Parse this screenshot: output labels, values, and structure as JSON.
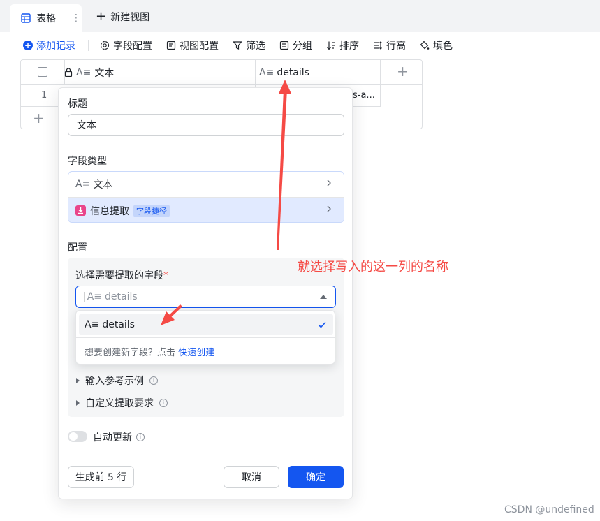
{
  "tabs": {
    "active_label": "表格",
    "more_icon": "more-vertical-icon",
    "new_view_label": "新建视图"
  },
  "toolbar": {
    "add_record": "添加记录",
    "field_config": "字段配置",
    "view_config": "视图配置",
    "filter": "筛选",
    "group": "分组",
    "sort": "排序",
    "row_height": "行高",
    "fill_color": "填色"
  },
  "grid": {
    "col_text": "文本",
    "col_details": "details",
    "row_number": "1",
    "truncated_cell": "s-a..."
  },
  "panel": {
    "title_label": "标题",
    "title_value": "文本",
    "field_type_label": "字段类型",
    "type_text": "文本",
    "type_extract": "信息提取",
    "type_extract_tag": "字段捷径",
    "config_label": "配置",
    "select_field_label": "选择需要提取的字段",
    "required_mark": "*",
    "select_value": "details",
    "example_label": "输入参考示例",
    "custom_label": "自定义提取要求",
    "auto_update_label": "自动更新",
    "generate_btn": "生成前 5 行",
    "cancel_btn": "取消",
    "confirm_btn": "确定"
  },
  "dropdown": {
    "option": "details",
    "footer_text": "想要创建新字段？点击",
    "footer_link": "快速创建"
  },
  "annotation": "就选择写入的这一列的名称",
  "watermark": "CSDN @undefined",
  "colors": {
    "primary": "#1456f0",
    "annotation_red": "#f54a45",
    "selected_bg": "#e1eaff"
  }
}
